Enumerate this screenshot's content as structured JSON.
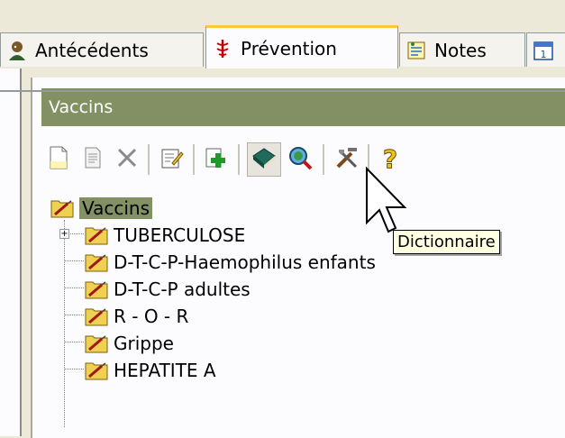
{
  "tabs": [
    {
      "label": "Antécédents",
      "icon": "person-icon"
    },
    {
      "label": "Prévention",
      "icon": "caduceus-icon",
      "active": true
    },
    {
      "label": "Notes",
      "icon": "notepad-icon"
    },
    {
      "label": "",
      "icon": "calendar-icon"
    }
  ],
  "panel": {
    "title": "Vaccins"
  },
  "toolbar": {
    "buttons": [
      "new-document-icon",
      "copy-document-icon",
      "delete-icon",
      "edit-icon",
      "add-icon",
      "dictionary-icon",
      "search-icon",
      "tools-icon",
      "help-icon"
    ],
    "pressed": "dictionary-icon"
  },
  "tree": {
    "root": "Vaccins",
    "items": [
      "TUBERCULOSE",
      "D-T-C-P-Haemophilus enfants",
      "D-T-C-P adultes",
      "R - O - R",
      "Grippe",
      "HEPATITE A"
    ]
  },
  "tooltip": "Dictionnaire",
  "colors": {
    "header": "#829063",
    "tab_accent": "#ffc73c"
  }
}
